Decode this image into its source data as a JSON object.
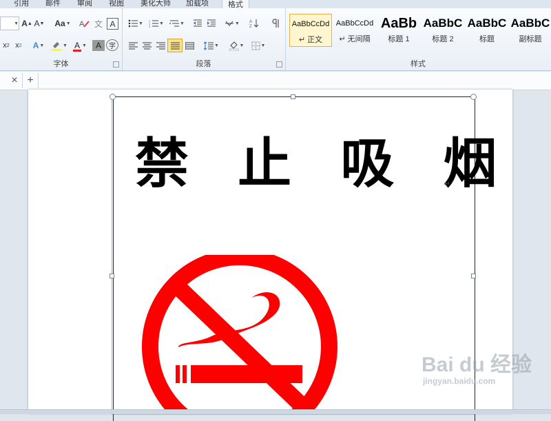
{
  "menu_tabs": [
    "引用",
    "邮件",
    "审阅",
    "视图",
    "美化大师",
    "加载项",
    "格式"
  ],
  "ribbon": {
    "font_group_label": "字体",
    "paragraph_group_label": "段落",
    "styles_group_label": "样式",
    "font": {
      "grow_label": "A",
      "shrink_label": "A",
      "case_label": "Aa",
      "phonetic_label": "文",
      "border_char_label": "A",
      "text_effect_label": "A",
      "font_color_label": "A",
      "char_shade_label": "A",
      "enclose_label": "字"
    },
    "styles": [
      {
        "preview": "AaBbCcDd",
        "name": "↵ 正文"
      },
      {
        "preview": "AaBbCcDd",
        "name": "↵ 无间隔"
      },
      {
        "preview": "AaBb",
        "name": "标题 1"
      },
      {
        "preview": "AaBbC",
        "name": "标题 2"
      },
      {
        "preview": "AaBbC",
        "name": "标题"
      },
      {
        "preview": "AaBbC",
        "name": "副标题"
      }
    ]
  },
  "doc_tabs": {
    "close_label": "×",
    "new_label": "+"
  },
  "document": {
    "title": "禁 止 吸 烟",
    "paragraph_mark": "↵"
  },
  "watermark": {
    "brand": "Bai du 经验",
    "url": "jingyan.baidu.com"
  },
  "colors": {
    "sign_red": "#ff0000",
    "highlight_yellow": "#ffff00",
    "accent_selection": "#fde58c"
  }
}
